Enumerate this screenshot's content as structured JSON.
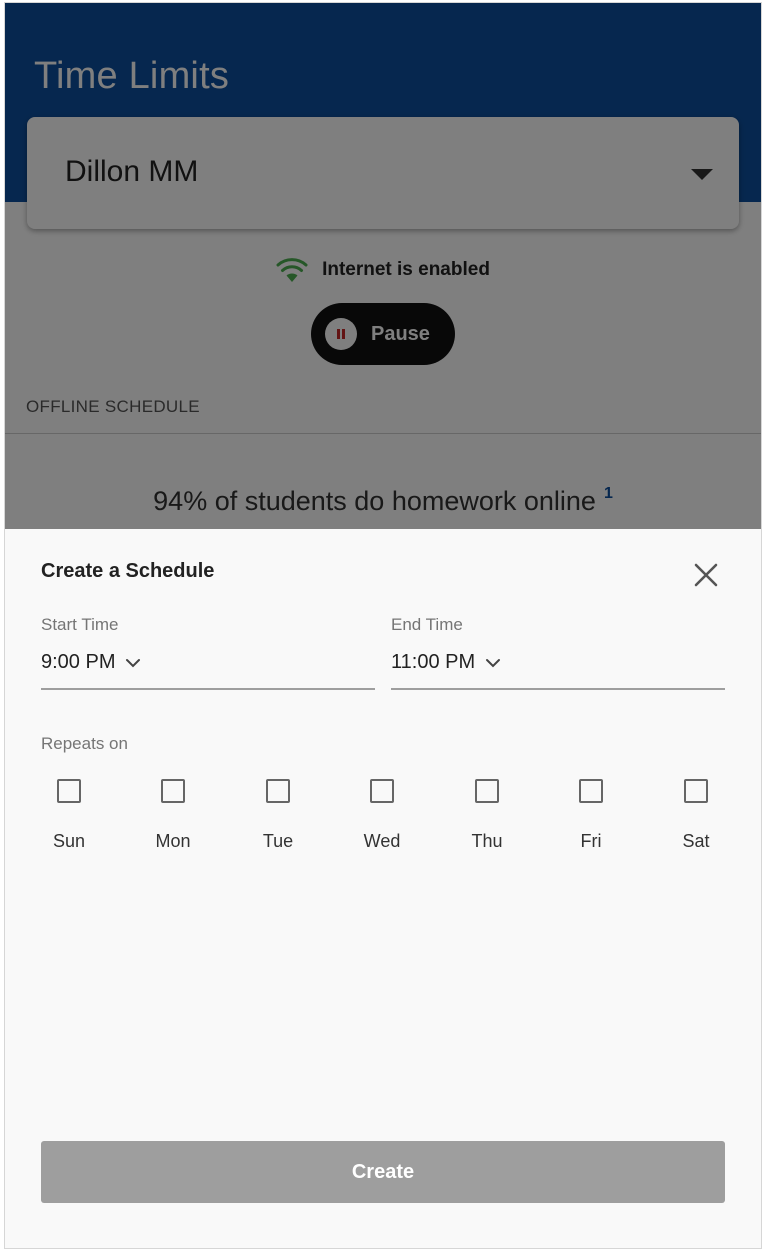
{
  "app": {
    "title": "Time Limits",
    "profile_name": "Dillon MM",
    "internet_status": "Internet is enabled",
    "pause_label": "Pause",
    "section_label": "OFFLINE SCHEDULE",
    "stat_text": "94% of students do homework online",
    "stat_footnote": "1"
  },
  "sheet": {
    "title": "Create a Schedule",
    "start_time_label": "Start Time",
    "start_time_value": "9:00 PM",
    "end_time_label": "End Time",
    "end_time_value": "11:00 PM",
    "repeats_label": "Repeats on",
    "days": [
      "Sun",
      "Mon",
      "Tue",
      "Wed",
      "Thu",
      "Fri",
      "Sat"
    ],
    "create_label": "Create"
  },
  "colors": {
    "header": "#0d4f9e",
    "wifi_icon": "#4caf50",
    "pause_icon": "#c62828",
    "create_button_disabled": "#9e9e9e"
  },
  "icons": {
    "wifi": "wifi-icon",
    "pause": "pause-icon",
    "close": "close-icon",
    "dropdown": "chevron-down-icon",
    "profile_dropdown": "caret-down-icon"
  }
}
